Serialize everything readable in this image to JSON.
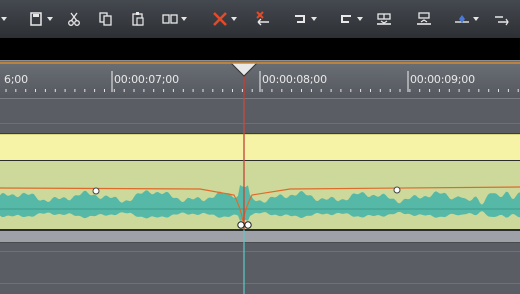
{
  "toolbar": {
    "buttons": [
      {
        "name": "save-icon",
        "glyph": "🖫",
        "has_dropdown": true
      },
      {
        "name": "cut-icon",
        "glyph": "✂",
        "has_dropdown": false
      },
      {
        "name": "copy-icon",
        "glyph": "⧉",
        "has_dropdown": false
      },
      {
        "name": "paste-icon",
        "glyph": "📋",
        "has_dropdown": false
      },
      {
        "name": "split-icon",
        "glyph": "⊟",
        "has_dropdown": true
      },
      {
        "name": "delete-icon",
        "glyph": "✕",
        "has_dropdown": true
      },
      {
        "name": "delete-ripple-icon",
        "glyph": "✕",
        "has_dropdown": false
      },
      {
        "name": "trim-start-icon",
        "glyph": "⊐",
        "has_dropdown": true
      },
      {
        "name": "trim-end-icon",
        "glyph": "⊏",
        "has_dropdown": true
      },
      {
        "name": "insert-track-icon",
        "glyph": "⊞",
        "has_dropdown": false
      },
      {
        "name": "extract-track-icon",
        "glyph": "⊠",
        "has_dropdown": false
      },
      {
        "name": "marker-icon",
        "glyph": "◆",
        "has_dropdown": true
      },
      {
        "name": "snap-icon",
        "glyph": "⇥",
        "has_dropdown": false
      }
    ],
    "accent": "#e24a2a"
  },
  "ruler": {
    "labels": [
      "6;00",
      "00:00:07;00",
      "00:00:08;00",
      "00:00:09;00"
    ]
  },
  "colors": {
    "playhead": "#d23a2a",
    "cursor_line": "#5ec8c8",
    "waveform": "#4fb7a8",
    "volume_line": "#e06a2a",
    "video_track": "#f6f3a6",
    "audio_track": "#ccd99a"
  }
}
